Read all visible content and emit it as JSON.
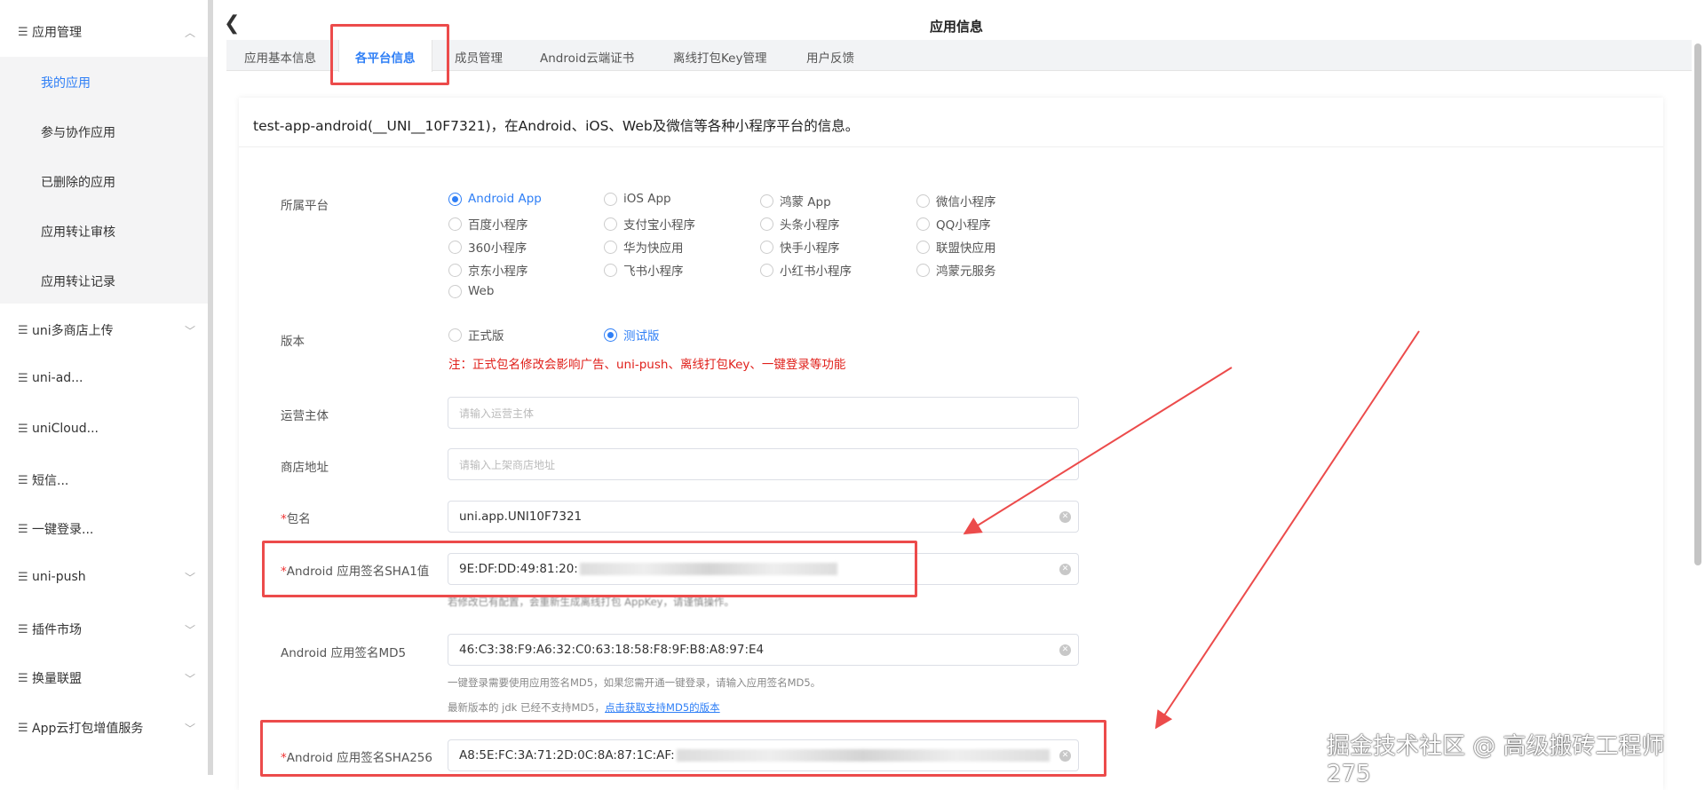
{
  "sidebar": {
    "group": "应用管理",
    "subitems": [
      "我的应用",
      "参与协作应用",
      "已删除的应用",
      "应用转让审核",
      "应用转让记录"
    ],
    "items": [
      "uni多商店上传",
      "uni-ad...",
      "uniCloud...",
      "短信...",
      "一键登录...",
      "uni-push",
      "插件市场",
      "换量联盟",
      "App云打包增值服务"
    ]
  },
  "header": {
    "title": "应用信息"
  },
  "tabs": [
    "应用基本信息",
    "各平台信息",
    "成员管理",
    "Android云端证书",
    "离线打包Key管理",
    "用户反馈"
  ],
  "card": {
    "title": "test-app-android(__UNI__10F7321)，在Android、iOS、Web及微信等各种小程序平台的信息。"
  },
  "form": {
    "platform_label": "所属平台",
    "platforms": [
      "Android App",
      "iOS App",
      "鸿蒙 App",
      "微信小程序",
      "百度小程序",
      "支付宝小程序",
      "头条小程序",
      "QQ小程序",
      "360小程序",
      "华为快应用",
      "快手小程序",
      "联盟快应用",
      "京东小程序",
      "飞书小程序",
      "小红书小程序",
      "鸿蒙元服务",
      "Web"
    ],
    "version_label": "版本",
    "versions": [
      "正式版",
      "测试版"
    ],
    "version_note": "注：正式包名修改会影响广告、uni-push、离线打包Key、一键登录等功能",
    "operator_label": "运营主体",
    "operator_placeholder": "请输入运营主体",
    "store_label": "商店地址",
    "store_placeholder": "请输入上架商店地址",
    "package_label": "包名",
    "package_value": "uni.app.UNI10F7321",
    "sha1_label": "Android 应用签名SHA1值",
    "sha1_value": "9E:DF:DD:49:81:20:",
    "sha1_hint": "若修改已有配置，会重新生成离线打包 AppKey，请谨慎操作。",
    "md5_label": "Android 应用签名MD5",
    "md5_value": "46:C3:38:F9:A6:32:C0:63:18:58:F8:9F:B8:A8:97:E4",
    "md5_hint": "一键登录需要使用应用签名MD5，如果您需开通一键登录，请输入应用签名MD5。",
    "md5_jdk_note": "最新版本的 jdk 已经不支持MD5，",
    "md5_link": "点击获取支持MD5的版本",
    "sha256_label": "Android 应用签名SHA256",
    "sha256_value": "A8:5E:FC:3A:71:2D:0C:8A:87:1C:AF:",
    "required_mark": "*"
  },
  "watermark": "掘金技术社区 @ 高级搬砖工程师275",
  "colors": {
    "accent": "#2f7ff6",
    "annotation": "#ec4b4b",
    "warning": "#e0201b"
  }
}
